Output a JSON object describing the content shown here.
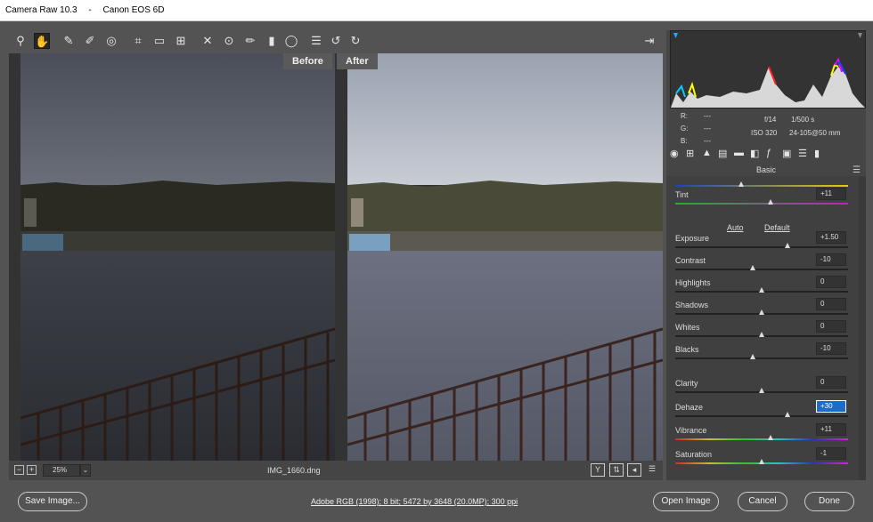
{
  "window": {
    "app_title": "Camera Raw 10.3",
    "separator": "-",
    "camera": "Canon EOS 6D"
  },
  "toolbar": {
    "icons": [
      "zoom-icon",
      "hand-icon",
      "white-balance-icon",
      "color-sampler-icon",
      "targeted-adjustment-icon",
      "crop-icon",
      "straighten-icon",
      "transform-icon",
      "spot-removal-icon",
      "red-eye-icon",
      "adjustment-brush-icon",
      "graduated-filter-icon",
      "radial-filter-icon",
      "presets-list-icon",
      "rotate-ccw-icon",
      "rotate-cw-icon"
    ],
    "preferences_icon": "preferences-icon"
  },
  "viewer": {
    "before_label": "Before",
    "after_label": "After"
  },
  "statusbar": {
    "zoom_out": "−",
    "zoom_in": "+",
    "zoom": "25%",
    "zoom_dropdown": "⌄",
    "filename": "IMG_1660.dng"
  },
  "info": {
    "r_label": "R:",
    "g_label": "G:",
    "b_label": "B:",
    "r": "---",
    "g": "---",
    "b": "---",
    "aperture": "f/14",
    "shutter": "1/500 s",
    "iso": "ISO 320",
    "lens": "24-105@50 mm"
  },
  "panel": {
    "title": "Basic",
    "auto_label": "Auto",
    "default_label": "Default",
    "sliders": [
      {
        "label": "",
        "value": "",
        "position": 0.38,
        "track": "blue-yellow"
      },
      {
        "label": "Tint",
        "value": "+11",
        "position": 0.55,
        "track": "green-magenta"
      },
      {
        "label": "Exposure",
        "value": "+1.50",
        "position": 0.65,
        "track": "dark"
      },
      {
        "label": "Contrast",
        "value": "-10",
        "position": 0.45,
        "track": "dark"
      },
      {
        "label": "Highlights",
        "value": "0",
        "position": 0.5,
        "track": "dark"
      },
      {
        "label": "Shadows",
        "value": "0",
        "position": 0.5,
        "track": "dark"
      },
      {
        "label": "Whites",
        "value": "0",
        "position": 0.5,
        "track": "dark"
      },
      {
        "label": "Blacks",
        "value": "-10",
        "position": 0.45,
        "track": "dark"
      },
      {
        "label": "Clarity",
        "value": "0",
        "position": 0.5,
        "track": "dark"
      },
      {
        "label": "Dehaze",
        "value": "+30",
        "position": 0.65,
        "track": "dark",
        "focused": true
      },
      {
        "label": "Vibrance",
        "value": "+11",
        "position": 0.55,
        "track": "spectrum"
      },
      {
        "label": "Saturation",
        "value": "-1",
        "position": 0.5,
        "track": "spectrum"
      }
    ]
  },
  "footer": {
    "save_image": "Save Image...",
    "workflow_link": "Adobe RGB (1998); 8 bit; 5472 by 3648 (20.0MP); 300 ppi",
    "open_image": "Open Image",
    "cancel": "Cancel",
    "done": "Done"
  },
  "colors": {
    "focus": "#1d6ccb",
    "background": "#535353",
    "panel": "#454545"
  }
}
